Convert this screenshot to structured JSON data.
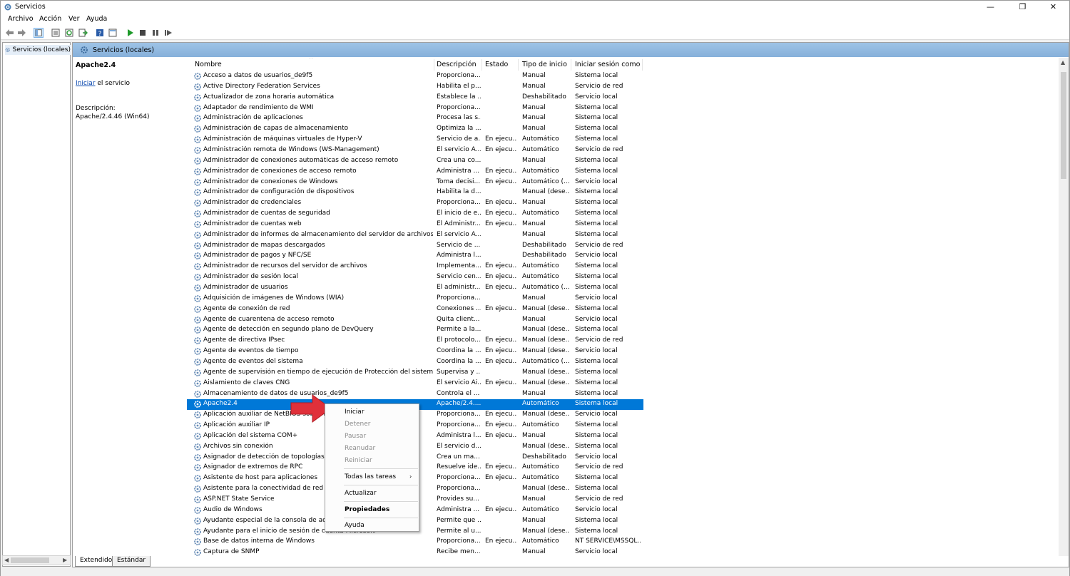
{
  "window": {
    "title": "Servicios",
    "minimize_glyph": "—",
    "restore_glyph": "❐",
    "close_glyph": "✕"
  },
  "menu": [
    "Archivo",
    "Acción",
    "Ver",
    "Ayuda"
  ],
  "toolbar": [
    "back-icon",
    "forward-icon",
    "console-tree-icon",
    "properties-icon",
    "refresh-icon",
    "export-icon",
    "help-icon",
    "show-hide-icon",
    "start-icon",
    "stop-icon",
    "pause-icon",
    "restart-icon"
  ],
  "tree": {
    "label": "Servicios (locales)"
  },
  "main_header": {
    "label": "Servicios (locales)"
  },
  "extended": {
    "name": "Apache2.4",
    "action_link": "Iniciar",
    "action_suffix": " el servicio",
    "description_label": "Descripción:",
    "description_value": "Apache/2.4.46 (Win64)"
  },
  "columns": [
    "Nombre",
    "Descripción",
    "Estado",
    "Tipo de inicio",
    "Iniciar sesión como"
  ],
  "sort_glyph": "^",
  "selected_row_index": 31,
  "rows": [
    [
      "Acceso a datos de usuarios_de9f5",
      "Proporciona...",
      "",
      "Manual",
      "Sistema local"
    ],
    [
      "Active Directory Federation Services",
      "Habilita el p...",
      "",
      "Manual",
      "Servicio de red"
    ],
    [
      "Actualizador de zona horaria automática",
      "Establece la ...",
      "",
      "Deshabilitado",
      "Servicio local"
    ],
    [
      "Adaptador de rendimiento de WMI",
      "Proporciona...",
      "",
      "Manual",
      "Sistema local"
    ],
    [
      "Administración de aplicaciones",
      "Procesa las s...",
      "",
      "Manual",
      "Sistema local"
    ],
    [
      "Administración de capas de almacenamiento",
      "Optimiza la ...",
      "",
      "Manual",
      "Sistema local"
    ],
    [
      "Administración de máquinas virtuales de Hyper-V",
      "Servicio de a...",
      "En ejecu...",
      "Automático",
      "Sistema local"
    ],
    [
      "Administración remota de Windows (WS-Management)",
      "El servicio A...",
      "En ejecu...",
      "Automático",
      "Servicio de red"
    ],
    [
      "Administrador de conexiones automáticas de acceso remoto",
      "Crea una co...",
      "",
      "Manual",
      "Sistema local"
    ],
    [
      "Administrador de conexiones de acceso remoto",
      "Administra ...",
      "En ejecu...",
      "Automático",
      "Sistema local"
    ],
    [
      "Administrador de conexiones de Windows",
      "Toma decisi...",
      "En ejecu...",
      "Automático (...",
      "Servicio local"
    ],
    [
      "Administrador de configuración de dispositivos",
      "Habilita la d...",
      "",
      "Manual (dese...",
      "Sistema local"
    ],
    [
      "Administrador de credenciales",
      "Proporciona...",
      "En ejecu...",
      "Manual",
      "Sistema local"
    ],
    [
      "Administrador de cuentas de seguridad",
      "El inicio de e...",
      "En ejecu...",
      "Automático",
      "Sistema local"
    ],
    [
      "Administrador de cuentas web",
      "El Administr...",
      "En ejecu...",
      "Manual",
      "Sistema local"
    ],
    [
      "Administrador de informes de almacenamiento del servidor de archivos",
      "El servicio A...",
      "",
      "Manual",
      "Sistema local"
    ],
    [
      "Administrador de mapas descargados",
      "Servicio de ...",
      "",
      "Deshabilitado",
      "Servicio de red"
    ],
    [
      "Administrador de pagos y NFC/SE",
      "Administra l...",
      "",
      "Deshabilitado",
      "Servicio local"
    ],
    [
      "Administrador de recursos del servidor de archivos",
      "Implementa...",
      "En ejecu...",
      "Automático",
      "Sistema local"
    ],
    [
      "Administrador de sesión local",
      "Servicio cen...",
      "En ejecu...",
      "Automático",
      "Sistema local"
    ],
    [
      "Administrador de usuarios",
      "El administr...",
      "En ejecu...",
      "Automático (...",
      "Sistema local"
    ],
    [
      "Adquisición de imágenes de Windows (WIA)",
      "Proporciona...",
      "",
      "Manual",
      "Servicio local"
    ],
    [
      "Agente de conexión de red",
      "Conexiones ...",
      "En ejecu...",
      "Manual (dese...",
      "Sistema local"
    ],
    [
      "Agente de cuarentena de acceso remoto",
      "Quita client...",
      "",
      "Manual",
      "Servicio local"
    ],
    [
      "Agente de detección en segundo plano de DevQuery",
      "Permite a la...",
      "",
      "Manual (dese...",
      "Sistema local"
    ],
    [
      "Agente de directiva IPsec",
      "El protocolo...",
      "En ejecu...",
      "Manual (dese...",
      "Servicio de red"
    ],
    [
      "Agente de eventos de tiempo",
      "Coordina la ...",
      "En ejecu...",
      "Manual (dese...",
      "Servicio local"
    ],
    [
      "Agente de eventos del sistema",
      "Coordina la ...",
      "En ejecu...",
      "Automático (...",
      "Sistema local"
    ],
    [
      "Agente de supervisión en tiempo de ejecución de Protección del sistema",
      "Supervisa y ...",
      "",
      "Manual (dese...",
      "Sistema local"
    ],
    [
      "Aislamiento de claves CNG",
      "El servicio Ai...",
      "En ejecu...",
      "Manual (dese...",
      "Sistema local"
    ],
    [
      "Almacenamiento de datos de usuarios_de9f5",
      "Controla el ...",
      "",
      "Manual",
      "Sistema local"
    ],
    [
      "Apache2.4",
      "Apache/2.4....",
      "",
      "Automático",
      "Sistema local"
    ],
    [
      "Aplicación auxiliar de NetBIOS sobre TCP/IP",
      "Proporciona...",
      "En ejecu...",
      "Manual (dese...",
      "Servicio local"
    ],
    [
      "Aplicación auxiliar IP",
      "Proporciona...",
      "En ejecu...",
      "Automático",
      "Sistema local"
    ],
    [
      "Aplicación del sistema COM+",
      "Administra l...",
      "En ejecu...",
      "Manual",
      "Sistema local"
    ],
    [
      "Archivos sin conexión",
      "El servicio d...",
      "",
      "Manual (dese...",
      "Sistema local"
    ],
    [
      "Asignador de detección de topologías de nivel de vínculo",
      "Crea un ma...",
      "",
      "Deshabilitado",
      "Servicio local"
    ],
    [
      "Asignador de extremos de RPC",
      "Resuelve ide...",
      "En ejecu...",
      "Automático",
      "Servicio de red"
    ],
    [
      "Asistente de host para aplicaciones",
      "Proporciona...",
      "En ejecu...",
      "Automático",
      "Sistema local"
    ],
    [
      "Asistente para la conectividad de red",
      "Proporciona...",
      "",
      "Manual (dese...",
      "Sistema local"
    ],
    [
      "ASP.NET State Service",
      "Provides su...",
      "",
      "Manual",
      "Servicio de red"
    ],
    [
      "Audio de Windows",
      "Administra ...",
      "En ejecu...",
      "Automático",
      "Servicio local"
    ],
    [
      "Ayudante especial de la consola de administración",
      "Permite que ...",
      "",
      "Manual",
      "Sistema local"
    ],
    [
      "Ayudante para el inicio de sesión de cuenta Microsoft",
      "Permite al u...",
      "",
      "Manual (dese...",
      "Sistema local"
    ],
    [
      "Base de datos interna de Windows",
      "Proporciona...",
      "En ejecu...",
      "Automático",
      "NT SERVICE\\MSSQL..."
    ],
    [
      "Captura de SNMP",
      "Recibe men...",
      "",
      "Manual",
      "Servicio local"
    ]
  ],
  "context_menu": {
    "start": "Iniciar",
    "stop": "Detener",
    "pause": "Pausar",
    "resume": "Reanudar",
    "restart": "Reiniciar",
    "all_tasks": "Todas las tareas",
    "refresh": "Actualizar",
    "properties": "Propiedades",
    "help": "Ayuda"
  },
  "tabs": [
    "Extendido",
    "Estándar"
  ],
  "colors": {
    "selection": "#0078d7",
    "header_bar": "#9ec3e6",
    "annotation_arrow": "#e0303a"
  }
}
